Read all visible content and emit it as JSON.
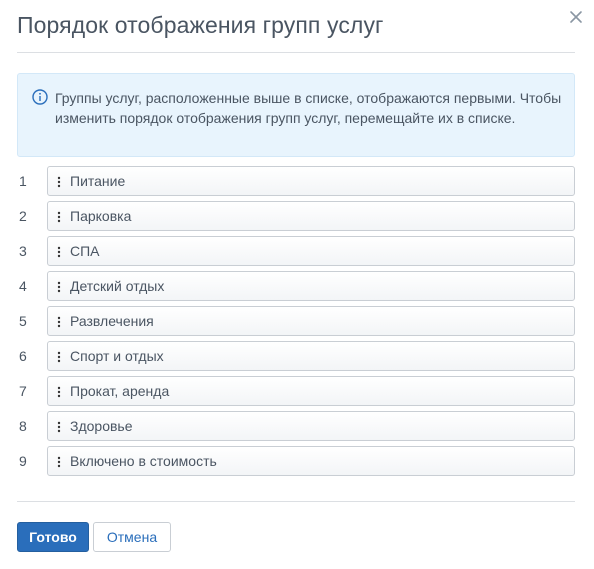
{
  "dialog": {
    "title": "Порядок отображения групп услуг"
  },
  "info": {
    "icon": "info-icon",
    "text": "Группы услуг, расположенные выше в списке, отображаются первыми. Чтобы изменить порядок отображения групп услуг, перемещайте их в списке."
  },
  "groups": [
    {
      "num": "1",
      "label": "Питание"
    },
    {
      "num": "2",
      "label": "Парковка"
    },
    {
      "num": "3",
      "label": "СПА"
    },
    {
      "num": "4",
      "label": "Детский отдых"
    },
    {
      "num": "5",
      "label": "Развлечения"
    },
    {
      "num": "6",
      "label": "Спорт и отдых"
    },
    {
      "num": "7",
      "label": "Прокат, аренда"
    },
    {
      "num": "8",
      "label": "Здоровье"
    },
    {
      "num": "9",
      "label": "Включено в стоимость"
    }
  ],
  "buttons": {
    "done": "Готово",
    "cancel": "Отмена"
  },
  "colors": {
    "primary": "#2a6ebb",
    "info_bg": "#e8f4fd",
    "text": "#4a5562"
  }
}
